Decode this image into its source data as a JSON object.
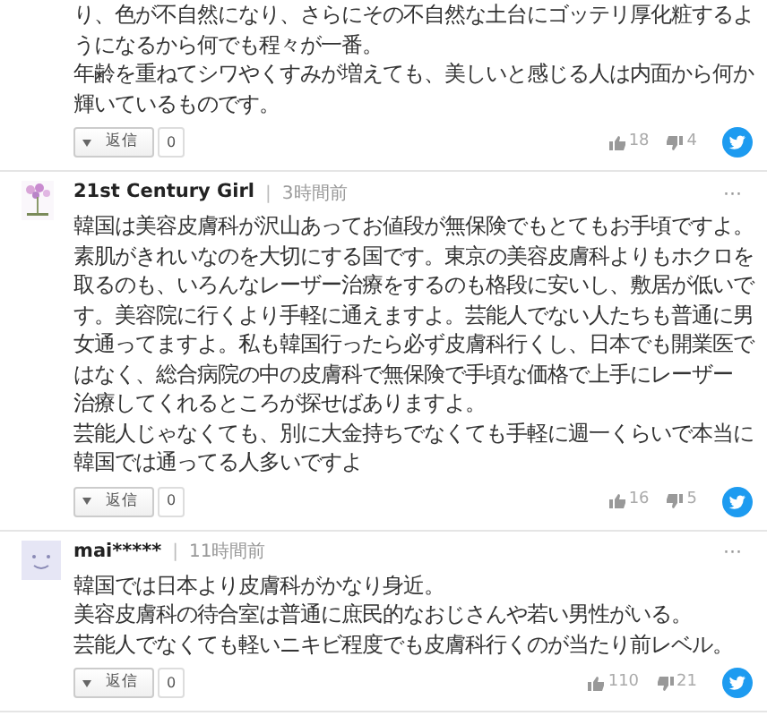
{
  "comments": [
    {
      "lines": [
        "り、色が不自然になり、さらにその不自然な土台にゴッテリ厚化粧するよ",
        "うになるから何でも程々が一番。",
        "年齢を重ねてシワやくすみが増えても、美しいと感じる人は内面から何か",
        "輝いているものです。"
      ],
      "reply": "返信",
      "reply_count": "0",
      "likes": "18",
      "dislikes": "4"
    },
    {
      "author": "21st Century Girl",
      "separator": "|",
      "time": "3時間前",
      "more": "···",
      "lines": [
        "韓国は美容皮膚科が沢山あってお値段が無保険でもとてもお手頃ですよ。",
        "素肌がきれいなのを大切にする国です。東京の美容皮膚科よりもホクロを",
        "取るのも、いろんなレーザー治療をするのも格段に安いし、敷居が低いで",
        "す。美容院に行くより手軽に通えますよ。芸能人でない人たちも普通に男",
        "女通ってますよ。私も韓国行ったら必ず皮膚科行くし、日本でも開業医で",
        "はなく、総合病院の中の皮膚科で無保険で手頃な価格で上手にレーザー",
        "治療してくれるところが探せばありますよ。",
        "芸能人じゃなくても、別に大金持ちでなくても手軽に週一くらいで本当に",
        "韓国では通ってる人多いですよ"
      ],
      "reply": "返信",
      "reply_count": "0",
      "likes": "16",
      "dislikes": "5"
    },
    {
      "author": "mai*****",
      "separator": "|",
      "time": "11時間前",
      "more": "···",
      "lines": [
        "韓国では日本より皮膚科がかなり身近。",
        "美容皮膚科の待合室は普通に庶民的なおじさんや若い男性がいる。",
        "芸能人でなくても軽いニキビ程度でも皮膚科行くのが当たり前レベル。"
      ],
      "reply": "返信",
      "reply_count": "0",
      "likes": "110",
      "dislikes": "21"
    }
  ]
}
